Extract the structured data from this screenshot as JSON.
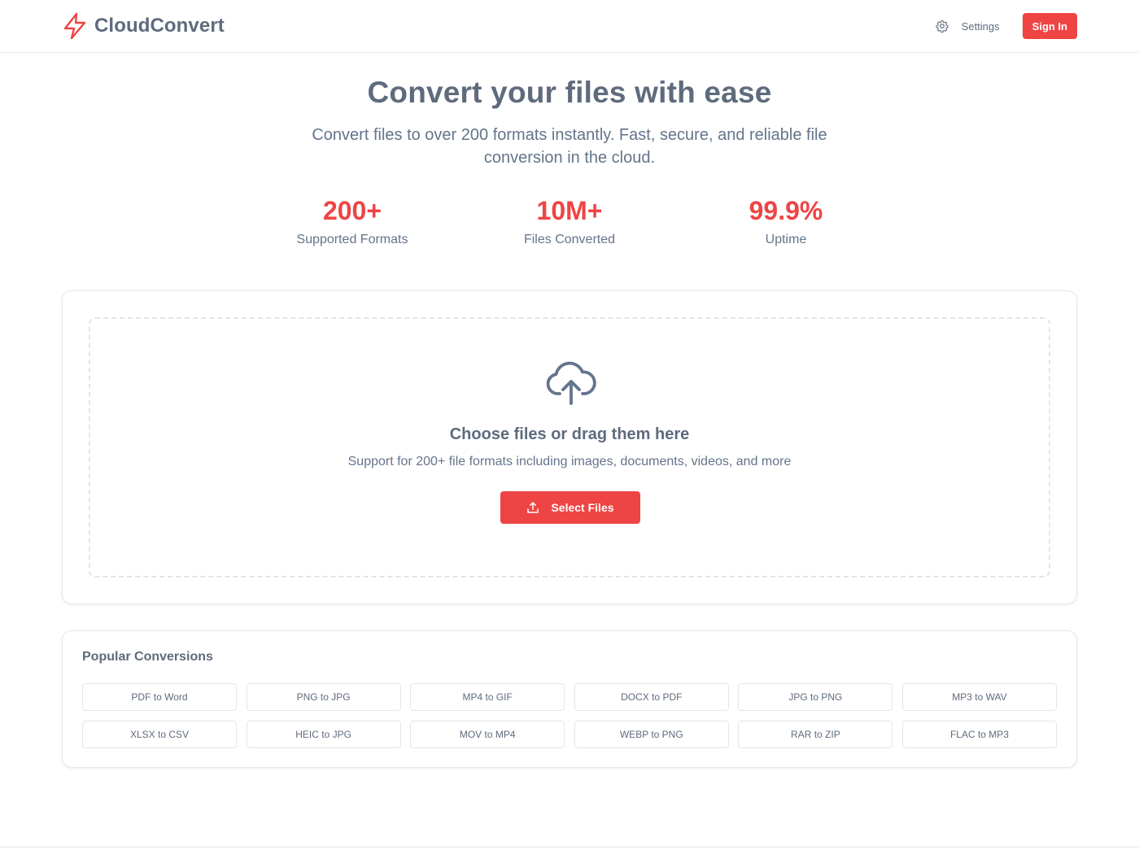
{
  "header": {
    "brand_name": "CloudConvert",
    "settings_label": "Settings",
    "signin_label": "Sign In"
  },
  "hero": {
    "title": "Convert your files with ease",
    "subtitle": "Convert files to over 200 formats instantly. Fast, secure, and reliable file conversion in the cloud."
  },
  "stats": [
    {
      "value": "200+",
      "label": "Supported Formats"
    },
    {
      "value": "10M+",
      "label": "Files Converted"
    },
    {
      "value": "99.9%",
      "label": "Uptime"
    }
  ],
  "upload": {
    "title": "Choose files or drag them here",
    "subtitle": "Support for 200+ file formats including images, documents, videos, and more",
    "button_label": "Select Files"
  },
  "popular": {
    "title": "Popular Conversions",
    "items": [
      "PDF to Word",
      "PNG to JPG",
      "MP4 to GIF",
      "DOCX to PDF",
      "JPG to PNG",
      "MP3 to WAV",
      "XLSX to CSV",
      "HEIC to JPG",
      "MOV to MP4",
      "WEBP to PNG",
      "RAR to ZIP",
      "FLAC to MP3"
    ]
  },
  "colors": {
    "accent": "#ef4444",
    "text_heading": "#5f6b7d",
    "text_body": "#64748b",
    "border": "#e5e7eb"
  },
  "icons": {
    "logo": "lightning-bolt-icon",
    "settings": "gear-icon",
    "upload": "cloud-upload-icon",
    "button": "upload-tray-icon"
  }
}
